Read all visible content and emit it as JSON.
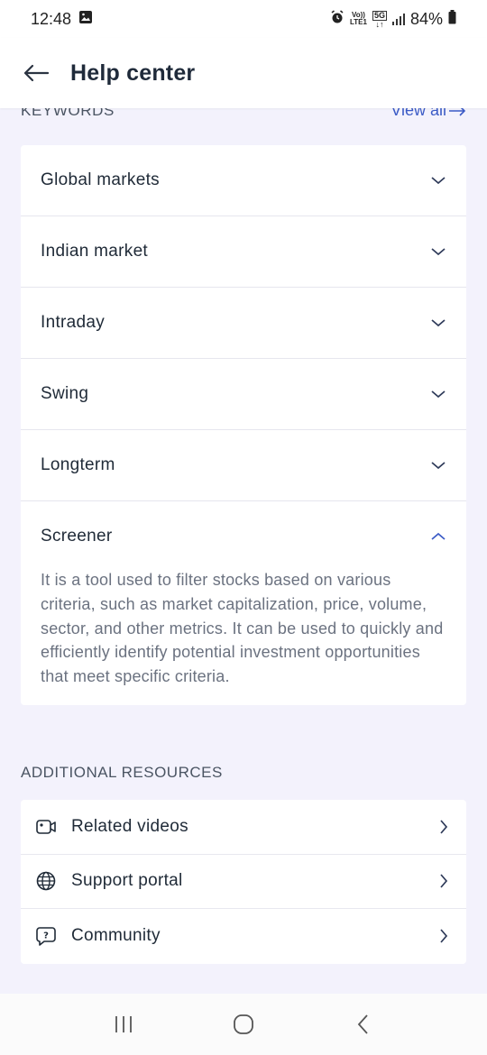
{
  "status": {
    "time": "12:48",
    "volte_top": "Vo))",
    "volte_bottom": "LTE1",
    "network": "5G",
    "battery": "84%"
  },
  "header": {
    "title": "Help center"
  },
  "keywords": {
    "label": "KEYWORDS",
    "view_all": "View all",
    "items": [
      {
        "title": "Global markets",
        "expanded": false
      },
      {
        "title": "Indian market",
        "expanded": false
      },
      {
        "title": "Intraday",
        "expanded": false
      },
      {
        "title": "Swing",
        "expanded": false
      },
      {
        "title": "Longterm",
        "expanded": false
      },
      {
        "title": "Screener",
        "expanded": true,
        "body": "It is a tool used to filter stocks based on various criteria, such as market capitalization, price, volume, sector, and other metrics. It can be used to quickly and efficiently identify potential investment opportunities that meet specific criteria."
      }
    ]
  },
  "resources": {
    "label": "ADDITIONAL RESOURCES",
    "items": [
      {
        "title": "Related videos",
        "icon": "video-icon"
      },
      {
        "title": "Support portal",
        "icon": "globe-icon"
      },
      {
        "title": "Community",
        "icon": "question-chat-icon"
      }
    ]
  },
  "colors": {
    "accent": "#3b5bc6",
    "background": "#f3f2fc",
    "text": "#1f2a37"
  }
}
